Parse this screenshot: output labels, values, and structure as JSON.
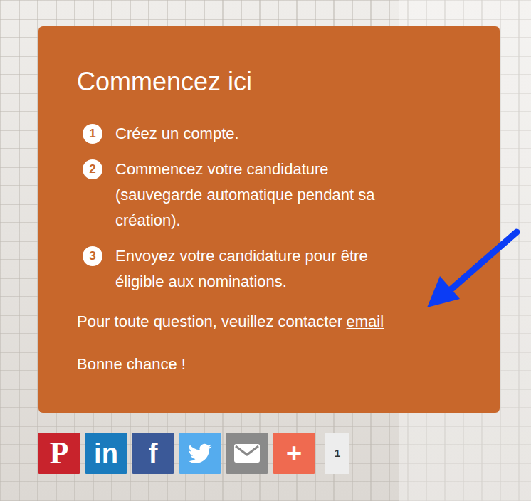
{
  "panel": {
    "title": "Commencez ici",
    "steps": [
      {
        "number": "1",
        "text": "Créez un compte."
      },
      {
        "number": "2",
        "text": "Commencez votre candidature (sauvegarde automatique pendant sa création)."
      },
      {
        "number": "3",
        "text": "Envoyez votre candidature pour être éligible aux nominations."
      }
    ],
    "contact": {
      "text": "Pour toute question, veuillez contacter",
      "link": "email"
    },
    "closing": "Bonne chance !"
  },
  "share": {
    "buttons": [
      {
        "kind": "glyph",
        "glyph": "P",
        "color": "#c8232c"
      },
      {
        "kind": "glyph",
        "glyph": "in",
        "color": "#1a7bbd"
      },
      {
        "kind": "glyph",
        "glyph": "f",
        "color": "#3b5998"
      },
      {
        "kind": "bird",
        "color": "#55acee"
      },
      {
        "kind": "envelope",
        "color": "#8a8a8a"
      },
      {
        "kind": "glyph",
        "glyph": "+",
        "color": "#ef6a50"
      }
    ],
    "count": "1"
  }
}
